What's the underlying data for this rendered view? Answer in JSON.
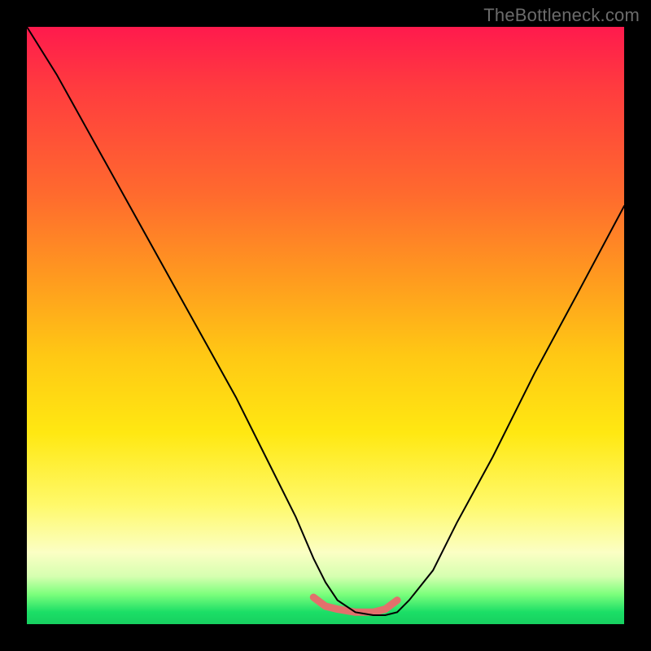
{
  "watermark": "TheBottleneck.com",
  "colors": {
    "frame": "#000000",
    "curve": "#000000",
    "accent_band": "#e2706c",
    "gradient_top": "#ff1a4d",
    "gradient_bottom": "#17d060"
  },
  "chart_data": {
    "type": "line",
    "title": "",
    "xlabel": "",
    "ylabel": "",
    "xlim": [
      0,
      100
    ],
    "ylim": [
      0,
      100
    ],
    "grid": false,
    "legend": false,
    "series": [
      {
        "name": "bottleneck-curve",
        "x": [
          0,
          5,
          10,
          15,
          20,
          25,
          30,
          35,
          40,
          45,
          48,
          50,
          52,
          55,
          58,
          60,
          62,
          64,
          68,
          72,
          78,
          85,
          92,
          100
        ],
        "y": [
          100,
          92,
          83,
          74,
          65,
          56,
          47,
          38,
          28,
          18,
          11,
          7,
          4,
          2,
          1.5,
          1.5,
          2,
          4,
          9,
          17,
          28,
          42,
          55,
          70
        ]
      }
    ],
    "accent_segment": {
      "name": "valley-highlight",
      "x": [
        48,
        50,
        52,
        55,
        58,
        60,
        62
      ],
      "y": [
        4.5,
        3,
        2.5,
        2,
        2,
        2.5,
        4
      ],
      "stroke_width_px": 9
    }
  }
}
